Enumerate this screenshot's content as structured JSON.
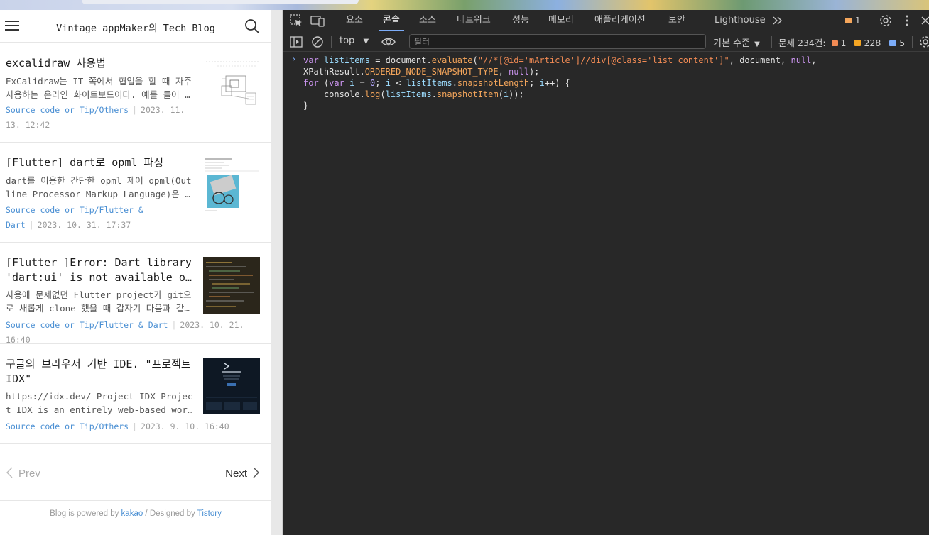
{
  "blog": {
    "title": "Vintage appMaker의 Tech Blog",
    "posts": [
      {
        "title": "excalidraw 사용법",
        "summary": "ExCalidraw는 IT 쪽에서 협업을 할 때 자주사용하는 온라인 화이트보드이다. 예를 들어 화면 설계, 흐름도 등을 그릴 때 유용하다.",
        "category": "Source code or Tip/Others",
        "date": "2023. 11. 13. 12:42"
      },
      {
        "title": "[Flutter] dart로 opml 파싱",
        "summary": "dart를 이용한 간단한 opml 제어 opml(Outline Processor Markup Language)은 XML 기반의 포맷이다.",
        "category": "Source code or Tip/Flutter & Dart",
        "date": "2023. 10. 31. 17:37"
      },
      {
        "title": "[Flutter ]Error: Dart library 'dart:ui' is not available on this platform",
        "summary": "사용에 문제없던 Flutter project가 git으로 새롭게 clone 했을 때 갑자기 다음과 같은 에러가 발생했다.",
        "category": "Source code or Tip/Flutter & Dart",
        "date": "2023. 10. 21. 16:40"
      },
      {
        "title": "구글의 브라우저 기반 IDE. \"프로젝트 IDX\"",
        "summary": "https://idx.dev/ Project IDX Project IDX is an entirely web-based workspace for full-stack development.",
        "category": "Source code or Tip/Others",
        "date": "2023. 9. 10. 16:40"
      }
    ],
    "pager": {
      "prev": "Prev",
      "next": "Next"
    },
    "footer": {
      "prefix": "Blog is powered by ",
      "kakao": "kakao",
      "middle": " / Designed by ",
      "tistory": "Tistory"
    }
  },
  "devtools": {
    "tabs": [
      "요소",
      "콘솔",
      "소스",
      "네트워크",
      "성능",
      "메모리",
      "애플리케이션",
      "보안",
      "Lighthouse"
    ],
    "active_tab": "콘솔",
    "tab_badge": "1",
    "toolbar": {
      "context": "top",
      "filter_placeholder": "필터",
      "level": "기본 수준",
      "issues_label": "문제 234건:",
      "issues_error": "1",
      "issues_warning": "228",
      "issues_info": "5"
    },
    "console_code": [
      "var listItems = document.evaluate(\"//*[@id='mArticle']//div[@class='list_content']\", document, null,",
      "XPathResult.ORDERED_NODE_SNAPSHOT_TYPE, null);",
      "for (var i = 0; i < listItems.snapshotLength; i++) {",
      "    console.log(listItems.snapshotItem(i));",
      "}"
    ]
  },
  "colors": {
    "accent": "#7cacf8",
    "link": "#4a8fd3",
    "devtools_bg": "#282828",
    "error": "#f28b54",
    "warning": "#f5a623"
  }
}
